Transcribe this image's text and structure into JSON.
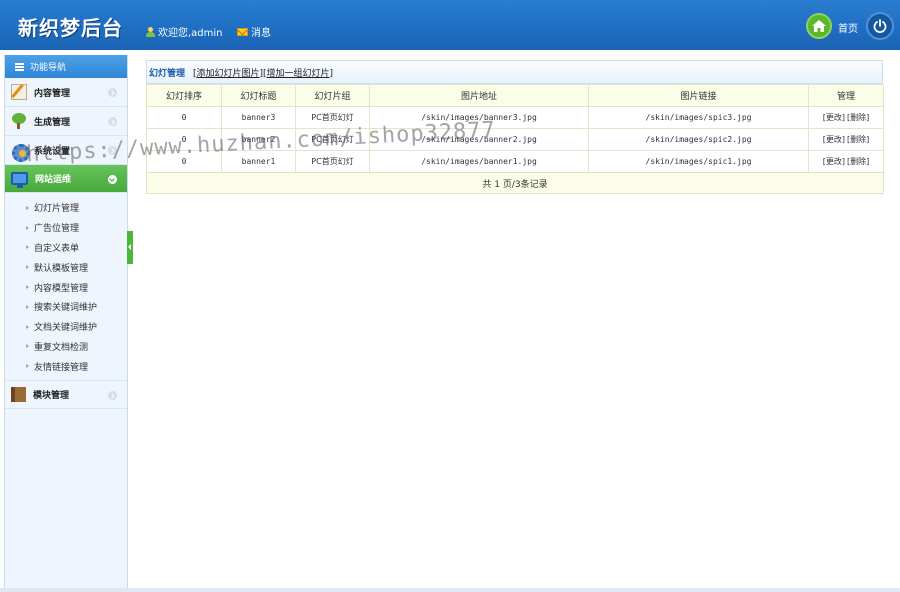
{
  "header": {
    "logo": "新织梦后台",
    "welcome": "欢迎您,admin",
    "messages": "消息",
    "home": "首页"
  },
  "sidebar": {
    "title": "功能导航",
    "categories": [
      {
        "label": "内容管理",
        "icon": "edit-icon"
      },
      {
        "label": "生成管理",
        "icon": "tree-icon"
      },
      {
        "label": "系统设置",
        "icon": "gear-icon"
      },
      {
        "label": "网站运维",
        "icon": "monitor-icon",
        "active": true
      },
      {
        "label": "模块管理",
        "icon": "book-icon"
      }
    ],
    "sub_items": [
      "幻灯片管理",
      "广告位管理",
      "自定义表单",
      "默认模板管理",
      "内容模型管理",
      "搜索关键词维护",
      "文档关键词维护",
      "重复文档检测",
      "友情链接管理"
    ]
  },
  "main": {
    "title": "幻灯管理",
    "link_add": "[添加幻灯片图片]",
    "link_add_group": "[增加一组幻灯片]",
    "columns": [
      "幻灯排序",
      "幻灯标题",
      "幻灯片组",
      "图片地址",
      "图片链接",
      "管理"
    ],
    "rows": [
      {
        "order": "0",
        "title": "banner3",
        "group": "PC首页幻灯",
        "image": "/skin/images/banner3.jpg",
        "link": "/skin/images/spic3.jpg",
        "edit": "[更改]",
        "delete": "[删除]"
      },
      {
        "order": "0",
        "title": "banner2",
        "group": "PC首页幻灯",
        "image": "/skin/images/banner2.jpg",
        "link": "/skin/images/spic2.jpg",
        "edit": "[更改]",
        "delete": "[删除]"
      },
      {
        "order": "0",
        "title": "banner1",
        "group": "PC首页幻灯",
        "image": "/skin/images/banner1.jpg",
        "link": "/skin/images/spic1.jpg",
        "edit": "[更改]",
        "delete": "[删除]"
      }
    ],
    "pagination": "共 1 页/3条记录"
  },
  "watermark": "https://www.huzhan.com/ishop32877",
  "colors": {
    "header_blue": "#1f6fc4",
    "active_green": "#4db73a",
    "link_blue": "#1d5da8"
  }
}
